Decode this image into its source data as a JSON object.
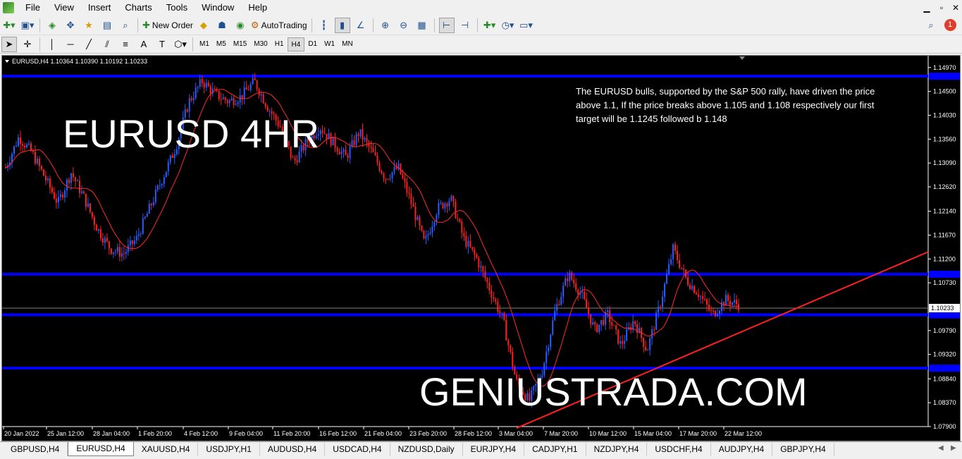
{
  "menu": {
    "items": [
      "File",
      "View",
      "Insert",
      "Charts",
      "Tools",
      "Window",
      "Help"
    ],
    "notification_count": "1"
  },
  "toolbar": {
    "new_order_label": "New Order",
    "autotrading_label": "AutoTrading"
  },
  "timeframes": [
    "M1",
    "M5",
    "M15",
    "M30",
    "H1",
    "H4",
    "D1",
    "W1",
    "MN"
  ],
  "active_timeframe": "H4",
  "chart": {
    "header": "EURUSD,H4  1.10364 1.10390 1.10192 1.10233",
    "big_title": "EURUSD 4HR",
    "watermark": "GENIUSTRADA.COM",
    "annotation_lines": [
      "The EURUSD bulls, supported by the S&P 500 rally, have driven the price",
      "above 1.1, If the price breaks above 1.105 and 1.108 respectively our first",
      "target will be 1.1245 followed b 1.148"
    ],
    "current_price_label": "1.10233",
    "colors": {
      "background": "#000000",
      "bull_candle": "#2a5cff",
      "bear_candle": "#ff1f1f",
      "levels": "#0000ff",
      "trendline": "#ff2020",
      "ma": "#ff2a2a",
      "text": "#ffffff"
    }
  },
  "chart_data": {
    "type": "candlestick",
    "symbol": "EURUSD",
    "timeframe": "H4",
    "ylim": [
      1.079,
      1.1487
    ],
    "y_ticks": [
      "1.14970",
      "1.14500",
      "1.14030",
      "1.13560",
      "1.13090",
      "1.12620",
      "1.12140",
      "1.11670",
      "1.11200",
      "1.10730",
      "1.10233",
      "1.09790",
      "1.09320",
      "1.08840",
      "1.08370",
      "1.07900"
    ],
    "x_ticks": [
      "20 Jan 2022",
      "25 Jan 12:00",
      "28 Jan 04:00",
      "1 Feb 20:00",
      "4 Feb 12:00",
      "9 Feb 04:00",
      "11 Feb 20:00",
      "16 Feb 12:00",
      "21 Feb 04:00",
      "23 Feb 20:00",
      "28 Feb 12:00",
      "3 Mar 04:00",
      "7 Mar 20:00",
      "10 Mar 12:00",
      "15 Mar 04:00",
      "17 Mar 20:00",
      "22 Mar 12:00"
    ],
    "horizontal_levels": [
      1.148,
      1.109,
      1.101,
      1.0905
    ],
    "trendline": {
      "start_price": 1.0787,
      "end_price": 1.1134
    },
    "price_path": [
      1.13,
      1.136,
      1.133,
      1.128,
      1.123,
      1.129,
      1.124,
      1.118,
      1.114,
      1.113,
      1.116,
      1.122,
      1.128,
      1.134,
      1.143,
      1.147,
      1.1445,
      1.143,
      1.144,
      1.147,
      1.142,
      1.138,
      1.131,
      1.135,
      1.138,
      1.135,
      1.132,
      1.137,
      1.133,
      1.128,
      1.13,
      1.123,
      1.115,
      1.122,
      1.124,
      1.116,
      1.112,
      1.106,
      1.1,
      1.088,
      1.084,
      1.09,
      1.102,
      1.109,
      1.105,
      1.098,
      1.101,
      1.095,
      1.1,
      1.094,
      1.103,
      1.114,
      1.108,
      1.105,
      1.101,
      1.104,
      1.103
    ]
  },
  "tabs": [
    "GBPUSD,H4",
    "EURUSD,H4",
    "XAUUSD,H4",
    "USDJPY,H1",
    "AUDUSD,H4",
    "USDCAD,H4",
    "NZDUSD,Daily",
    "EURJPY,H4",
    "CADJPY,H1",
    "NZDJPY,H4",
    "USDCHF,H4",
    "AUDJPY,H4",
    "GBPJPY,H4"
  ],
  "active_tab": "EURUSD,H4"
}
